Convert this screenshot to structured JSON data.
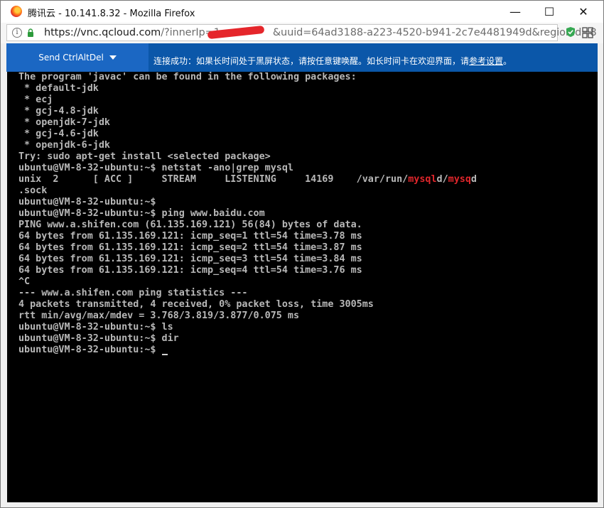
{
  "window": {
    "title": "腾讯云 - 10.141.8.32 - Mozilla Firefox",
    "minimize_glyph": "—",
    "maximize_glyph": "☐",
    "close_glyph": "✕"
  },
  "urlbar": {
    "url_host": "https://vnc.qcloud.com",
    "url_path_a": "/?innerIp=1",
    "url_path_b": "&uuid=64ad3188-a223-4520-b941-2c7e4481949d&regionId=8",
    "info_glyph": "i"
  },
  "vnc_bar": {
    "send_button_label": "Send CtrlAltDel",
    "notice_text": "连接成功：如果长时间处于黑屏状态，请按任意键唤醒。如长时间卡在欢迎界面，请",
    "notice_link": "参考设置",
    "notice_end": "。"
  },
  "terminal": {
    "lines": [
      "The program 'javac' can be found in the following packages:",
      " * default-jdk",
      " * ecj",
      " * gcj-4.8-jdk",
      " * openjdk-7-jdk",
      " * gcj-4.6-jdk",
      " * openjdk-6-jdk",
      "Try: sudo apt-get install <selected package>",
      "ubuntu@VM-8-32-ubuntu:~$ netstat -ano|grep mysql",
      "",
      ".sock",
      "ubuntu@VM-8-32-ubuntu:~$",
      "ubuntu@VM-8-32-ubuntu:~$ ping www.baidu.com",
      "PING www.a.shifen.com (61.135.169.121) 56(84) bytes of data.",
      "64 bytes from 61.135.169.121: icmp_seq=1 ttl=54 time=3.78 ms",
      "64 bytes from 61.135.169.121: icmp_seq=2 ttl=54 time=3.87 ms",
      "64 bytes from 61.135.169.121: icmp_seq=3 ttl=54 time=3.84 ms",
      "64 bytes from 61.135.169.121: icmp_seq=4 ttl=54 time=3.76 ms",
      "^C",
      "--- www.a.shifen.com ping statistics ---",
      "4 packets transmitted, 4 received, 0% packet loss, time 3005ms",
      "rtt min/avg/max/mdev = 3.768/3.819/3.877/0.075 ms",
      "ubuntu@VM-8-32-ubuntu:~$ ls",
      "ubuntu@VM-8-32-ubuntu:~$ dir",
      "ubuntu@VM-8-32-ubuntu:~$ "
    ],
    "netstat_row": {
      "prefix": "unix  2      [ ACC ]     STREAM     LISTENING     14169    /var/run/",
      "hl1": "mysql",
      "mid": "d/",
      "hl2": "mysq",
      "end": "d"
    }
  }
}
